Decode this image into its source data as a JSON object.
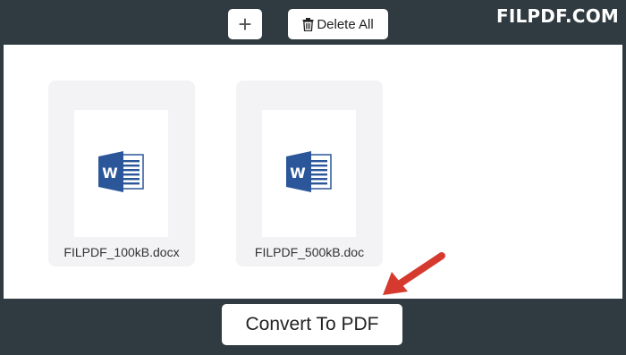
{
  "toolbar": {
    "add_label": "+",
    "delete_all_label": "Delete All"
  },
  "brand": "FILPDF.COM",
  "files": [
    {
      "name": "FILPDF_100kB.docx",
      "icon": "word-doc-icon"
    },
    {
      "name": "FILPDF_500kB.doc",
      "icon": "word-doc-icon"
    }
  ],
  "convert_label": "Convert To PDF",
  "colors": {
    "frame": "#2f3b41",
    "word_blue": "#2b579a",
    "arrow_red": "#d63a2f"
  }
}
